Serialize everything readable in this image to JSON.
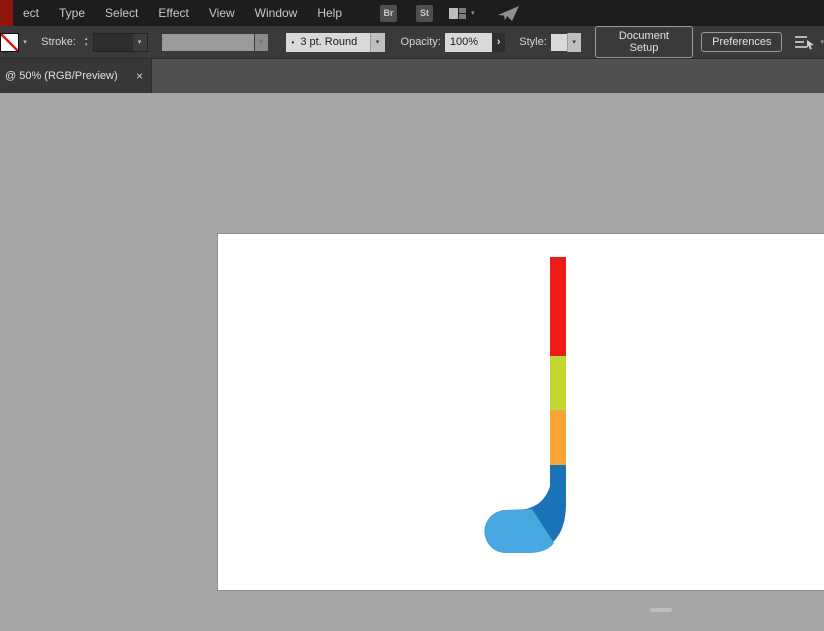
{
  "menu_bar": {
    "items": [
      {
        "label": "ect"
      },
      {
        "label": "Type"
      },
      {
        "label": "Select"
      },
      {
        "label": "Effect"
      },
      {
        "label": "View"
      },
      {
        "label": "Window"
      },
      {
        "label": "Help"
      }
    ],
    "bridge_badge": "Br",
    "stock_badge": "St"
  },
  "control_bar": {
    "stroke_label": "Stroke:",
    "stroke_weight_value": "",
    "brush_dot": "•",
    "brush_value": "3 pt. Round",
    "opacity_label": "Opacity:",
    "opacity_value": "100%",
    "options_arrow": "›",
    "style_label": "Style:",
    "document_setup_button": "Document Setup",
    "preferences_button": "Preferences"
  },
  "tab_bar": {
    "active_tab_title": "@ 50% (RGB/Preview)",
    "close_glyph": "×"
  },
  "artwork": {
    "description": "hockey stick illustration on white artboard",
    "red": "#ed1c16",
    "yellow_green": "#c3d730",
    "orange": "#f9a435",
    "dark_blue": "#1b73b7",
    "light_blue": "#46a8de"
  },
  "ui": {
    "chevron_down": "▾",
    "stepper_up": "▴",
    "stepper_down": "▾"
  }
}
